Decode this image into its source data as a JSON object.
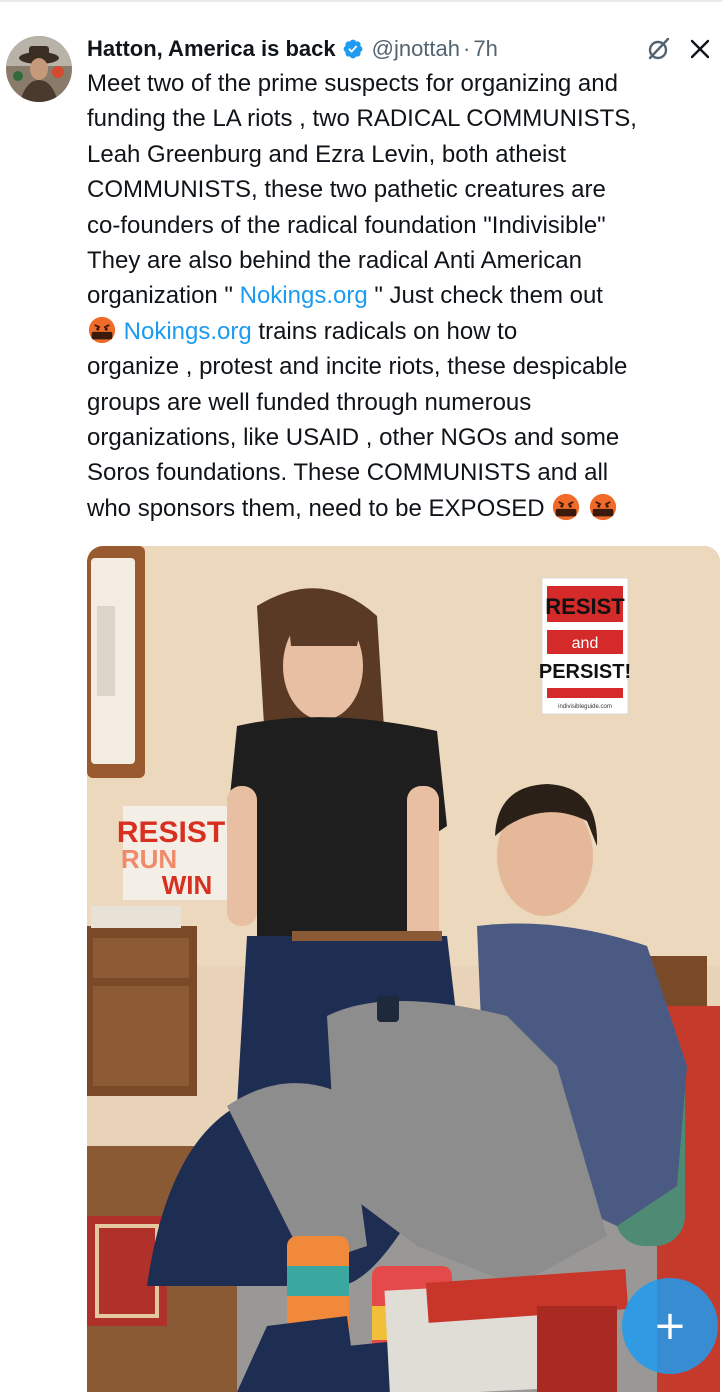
{
  "author": {
    "name": "Hatton, America is back",
    "handle": "@jnottah",
    "separator": "·",
    "time": "7h",
    "verified": true
  },
  "icons": {
    "avatar": "avatar",
    "verified": "verified-badge-icon",
    "grok": "grok-icon",
    "close": "close-icon",
    "emoji": "face-with-symbols-on-mouth-emoji",
    "compose": "compose-plus-icon"
  },
  "tweet": {
    "l1": "Meet two of the prime suspects for organizing and",
    "l2": "funding the LA riots , two RADICAL COMMUNISTS,",
    "l3": "Leah Greenburg and Ezra Levin,  both atheist",
    "l4": "COMMUNISTS, these two pathetic creatures are",
    "l5": "co-founders of the radical foundation \"Indivisible\"",
    "l6": "They are also behind the radical Anti American",
    "l7a": "organization \" ",
    "l7link": "Nokings.org",
    "l7b": " \"  Just check them out",
    "l8link": "Nokings.org",
    "l8b": "  trains radicals on how to",
    "l9": "organize , protest and incite riots, these despicable",
    "l10": "groups are well funded through numerous",
    "l11": "organizations,  like USAID , other NGOs and some",
    "l12": "Soros foundations. These COMMUNISTS and all",
    "l13": "who sponsors them, need to be EXPOSED "
  },
  "photo": {
    "poster1": {
      "line1": "RESIST",
      "line2": "and",
      "line3": "PERSIST!",
      "footer": "indivisibleguide.com"
    },
    "poster2": {
      "line1": "RESIST",
      "line2": "RUN",
      "line3": "WIN"
    }
  },
  "fab": {
    "label": "+"
  },
  "colors": {
    "text": "#0f1419",
    "secondary": "#536471",
    "link": "#1d9bf0",
    "fab": "#1d9bf0"
  }
}
